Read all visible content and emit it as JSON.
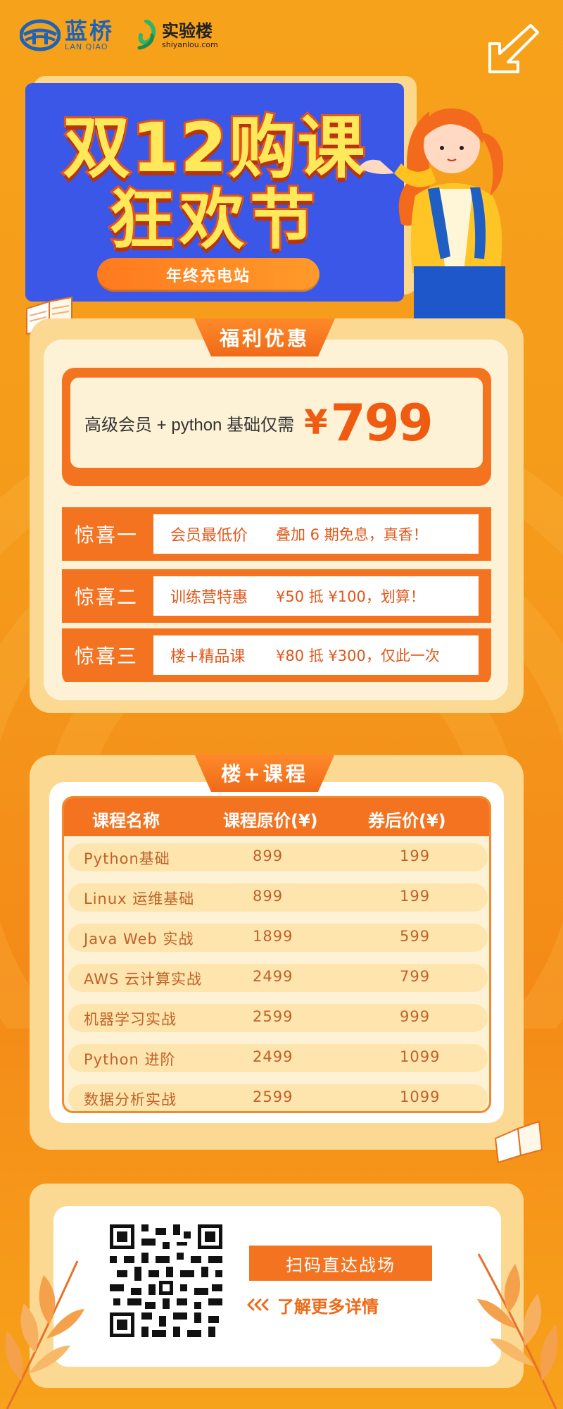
{
  "logos": {
    "lanqiao_cn": "蓝桥",
    "lanqiao_en": "LAN QIAO",
    "shiyanlou_cn": "实验楼",
    "shiyanlou_en": "shiyanlou.com"
  },
  "hero": {
    "title_line1": "双12购课",
    "title_line2": "狂欢节",
    "subtitle": "年终充电站"
  },
  "offers": {
    "tab": "福利优惠",
    "bundle_label": "高级会员 + python 基础仅需",
    "currency": "¥",
    "price": "799",
    "surprises": [
      {
        "name": "惊喜一",
        "title": "会员最低价",
        "desc": "叠加 6 期免息，真香！"
      },
      {
        "name": "惊喜二",
        "title": "训练营特惠",
        "desc": "¥50 抵 ¥100，划算！"
      },
      {
        "name": "惊喜三",
        "title": "楼+精品课",
        "desc": "¥80 抵 ¥300，仅此一次"
      }
    ]
  },
  "courses": {
    "tab": "楼+课程",
    "headers": [
      "课程名称",
      "课程原价(¥)",
      "券后价(¥)"
    ],
    "rows": [
      [
        "Python基础",
        "899",
        "199"
      ],
      [
        "Linux 运维基础",
        "899",
        "199"
      ],
      [
        "Java Web 实战",
        "1899",
        "599"
      ],
      [
        "AWS 云计算实战",
        "2499",
        "799"
      ],
      [
        "机器学习实战",
        "2599",
        "999"
      ],
      [
        "Python 进阶",
        "2499",
        "1099"
      ],
      [
        "数据分析实战",
        "2599",
        "1099"
      ]
    ]
  },
  "footer": {
    "cta": "扫码直达战场",
    "more": "了解更多详情"
  },
  "colors": {
    "brand_orange": "#f37321",
    "hero_blue": "#3a57e8",
    "cream": "#fef2d6",
    "lanqiao_blue": "#1d63b8"
  },
  "icons": [
    "lanqiao-logo-icon",
    "shiyanlou-logo-icon",
    "arrow-down-left-icon",
    "book-icon",
    "qr-code-icon",
    "triple-chevron-left-icon",
    "leaf-icon"
  ]
}
